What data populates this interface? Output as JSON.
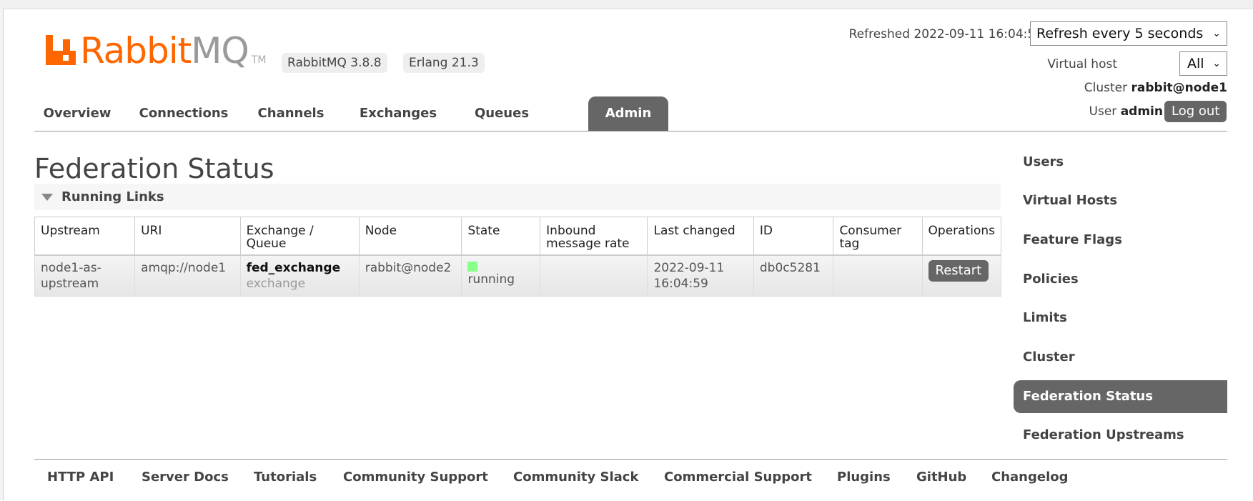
{
  "header": {
    "logo_text_orange": "Rabbit",
    "logo_text_gray": "MQ",
    "logo_tm": "TM",
    "version_rabbit": "RabbitMQ 3.8.8",
    "version_erlang": "Erlang 21.3",
    "refreshed_label": "Refreshed 2022-09-11 16:04:59",
    "refresh_select_value": "Refresh every 5 seconds",
    "vhost_label": "Virtual host",
    "vhost_value": "All",
    "cluster_label": "Cluster",
    "cluster_value": "rabbit@node1",
    "user_label": "User",
    "user_value": "admin",
    "logout_label": "Log out"
  },
  "tabs": [
    "Overview",
    "Connections",
    "Channels",
    "Exchanges",
    "Queues",
    "Admin"
  ],
  "active_tab": "Admin",
  "page": {
    "title": "Federation Status",
    "section_title": "Running Links"
  },
  "table": {
    "headers": [
      "Upstream",
      "URI",
      "Exchange / Queue",
      "Node",
      "State",
      "Inbound message rate",
      "Last changed",
      "ID",
      "Consumer tag",
      "Operations"
    ],
    "row": {
      "upstream": "node1-as-upstream",
      "uri": "amqp://node1",
      "exchange_name": "fed_exchange",
      "exchange_type": "exchange",
      "node": "rabbit@node2",
      "state": "running",
      "inbound_rate": "",
      "last_changed": "2022-09-11 16:04:59",
      "id": "db0c5281",
      "consumer_tag": "",
      "operation_label": "Restart"
    }
  },
  "sidebar": {
    "items": [
      "Users",
      "Virtual Hosts",
      "Feature Flags",
      "Policies",
      "Limits",
      "Cluster",
      "Federation Status",
      "Federation Upstreams"
    ],
    "active": "Federation Status"
  },
  "footer": {
    "links": [
      "HTTP API",
      "Server Docs",
      "Tutorials",
      "Community Support",
      "Community Slack",
      "Commercial Support",
      "Plugins",
      "GitHub",
      "Changelog"
    ]
  },
  "colors": {
    "brand_orange": "#ff6600",
    "active_tab_bg": "#666666",
    "state_running": "#88ff88"
  }
}
